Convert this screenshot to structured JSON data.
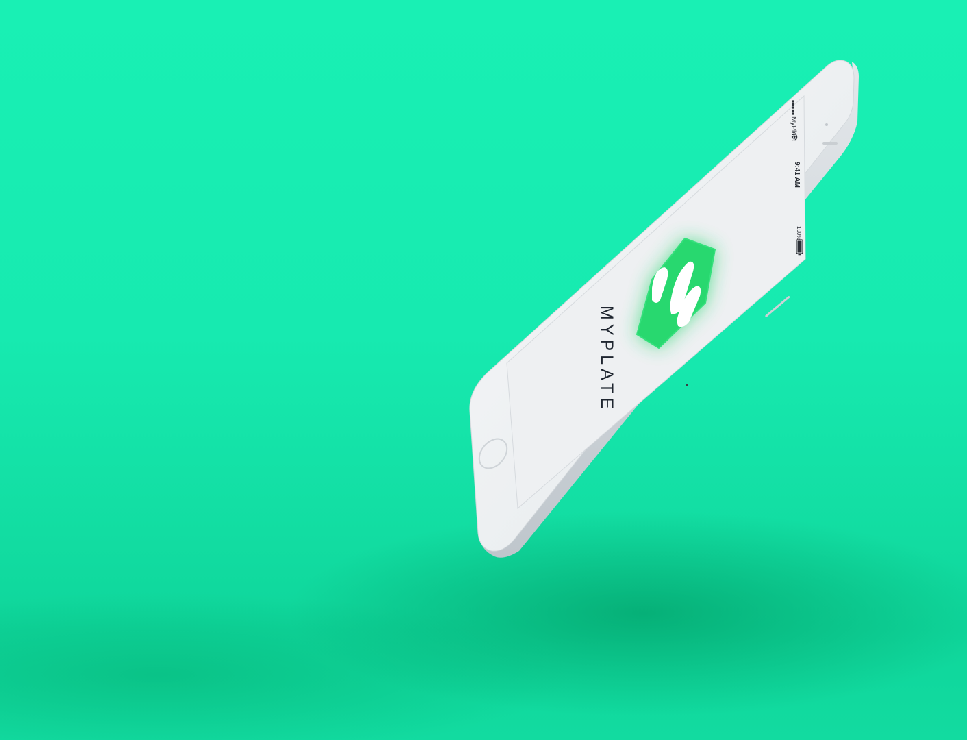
{
  "app": {
    "name": "MYPLATE",
    "brand_color": "#28d86f",
    "logo_icon": "myplate-logo-icon"
  },
  "status_bar": {
    "carrier": "MyPlate",
    "time": "9:41 AM",
    "battery": "100%",
    "signal_icon": "signal-dots-icon",
    "wifi_icon": "wifi-icon",
    "battery_icon": "battery-icon"
  },
  "device": {
    "model": "white smartphone",
    "home_button_icon": "home-button-icon"
  },
  "colors": {
    "background": "#19f0b4",
    "screen": "#eef0f2",
    "logo_green": "#28d86f"
  }
}
